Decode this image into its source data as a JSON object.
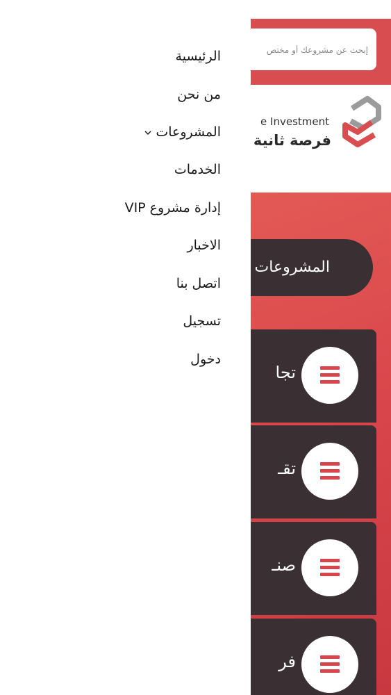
{
  "drawer": {
    "items": [
      {
        "label": "الرئيسية"
      },
      {
        "label": "من نحن"
      },
      {
        "label": "المشروعات",
        "has_dropdown": true,
        "icon": "chevron-down-icon"
      },
      {
        "label": "الخدمات"
      },
      {
        "label": "إدارة مشروع VIP"
      },
      {
        "label": "الاخبار"
      },
      {
        "label": "اتصل بنا"
      },
      {
        "label": "تسجيل"
      },
      {
        "label": "دخول"
      }
    ]
  },
  "header": {
    "search_placeholder": "إبحث عن مشروعك أو مختص",
    "logo_en": "e Investment",
    "logo_ar": "فرصة ثانية"
  },
  "main": {
    "projects_title": "المشروعات",
    "categories": [
      {
        "label": "تجا",
        "icon": "menu-icon"
      },
      {
        "label": "تقـ",
        "icon": "menu-icon"
      },
      {
        "label": "صنـ",
        "icon": "menu-icon"
      },
      {
        "label": "فر",
        "icon": "menu-icon"
      }
    ]
  },
  "colors": {
    "brand_red": "#d84e50",
    "dark_card": "#3a3034",
    "logo_gray": "#9b9b9b"
  }
}
